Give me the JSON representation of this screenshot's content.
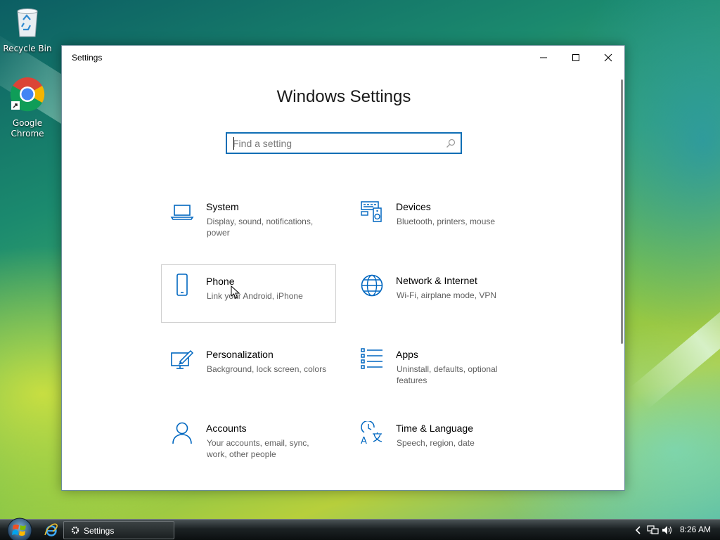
{
  "desktop": {
    "icons": [
      {
        "label_line1": "Recycle Bin",
        "label_line2": ""
      },
      {
        "label_line1": "Google",
        "label_line2": "Chrome"
      }
    ]
  },
  "window": {
    "title": "Settings",
    "heading": "Windows Settings",
    "search": {
      "placeholder": "Find a setting",
      "value": ""
    },
    "categories": [
      {
        "name": "System",
        "description": "Display, sound, notifications, power",
        "icon": "laptop-icon"
      },
      {
        "name": "Devices",
        "description": "Bluetooth, printers, mouse",
        "icon": "devices-icon"
      },
      {
        "name": "Phone",
        "description": "Link your Android, iPhone",
        "icon": "phone-icon"
      },
      {
        "name": "Network & Internet",
        "description": "Wi-Fi, airplane mode, VPN",
        "icon": "globe-icon"
      },
      {
        "name": "Personalization",
        "description": "Background, lock screen, colors",
        "icon": "paint-icon"
      },
      {
        "name": "Apps",
        "description": "Uninstall, defaults, optional features",
        "icon": "apps-list-icon"
      },
      {
        "name": "Accounts",
        "description": "Your accounts, email, sync, work, other people",
        "icon": "person-icon"
      },
      {
        "name": "Time & Language",
        "description": "Speech, region, date",
        "icon": "time-language-icon"
      }
    ]
  },
  "taskbar": {
    "active_app": "Settings",
    "clock": "8:26 AM"
  },
  "colors": {
    "accent": "#0f6eb5",
    "icon_blue": "#0067c0",
    "desc_gray": "#5f5f5f"
  }
}
